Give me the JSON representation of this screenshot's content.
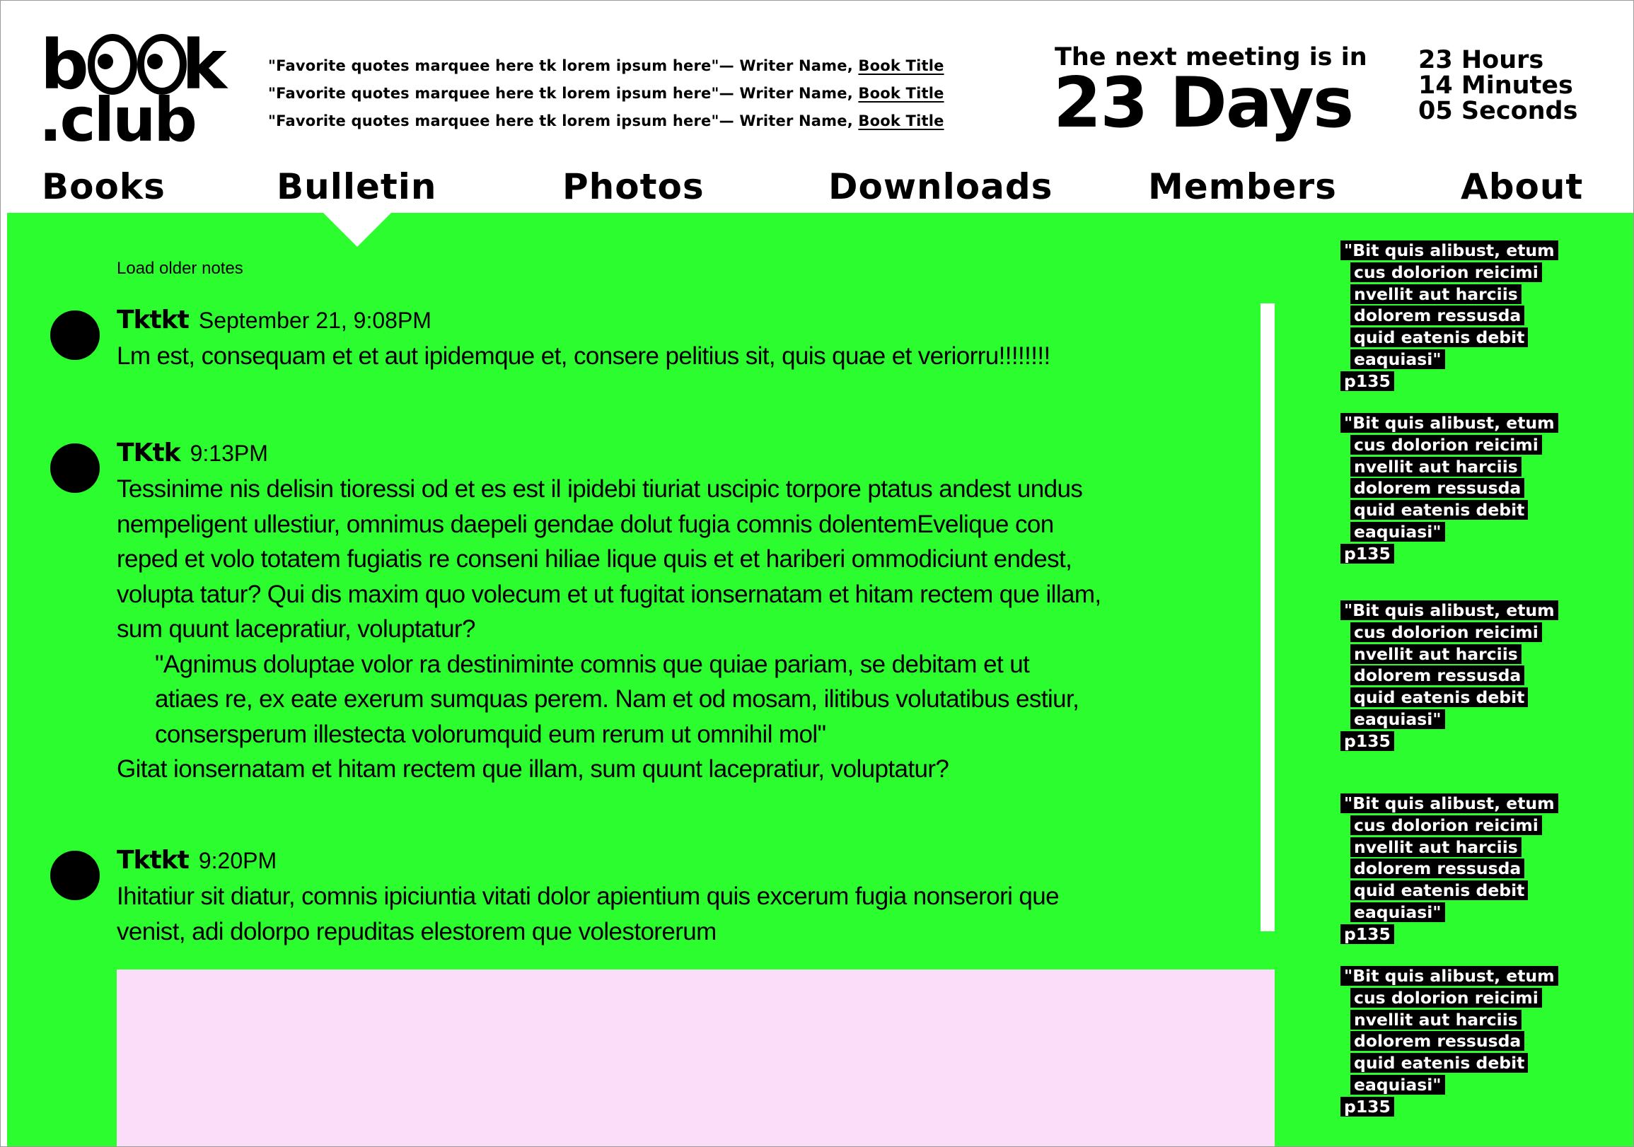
{
  "logo": {
    "top": "b  k",
    "bottom": ".club"
  },
  "header": {
    "quotes": [
      {
        "quote": "\"Favorite quotes marquee here tk lorem ipsum here\"",
        "attribution": "— Writer Name, ",
        "book": "Book Title"
      },
      {
        "quote": "\"Favorite quotes marquee here tk lorem ipsum here\"",
        "attribution": "— Writer Name, ",
        "book": "Book Title"
      },
      {
        "quote": "\"Favorite quotes marquee here tk lorem ipsum here\"",
        "attribution": "— Writer Name, ",
        "book": "Book Title"
      }
    ],
    "countdown": {
      "lead": "The next meeting is in",
      "days": "23 Days",
      "hours": "23 Hours",
      "minutes": "14 Minutes",
      "seconds": "05 Seconds"
    }
  },
  "nav": {
    "items": [
      {
        "label": "Books"
      },
      {
        "label": "Bulletin"
      },
      {
        "label": "Photos"
      },
      {
        "label": "Downloads"
      },
      {
        "label": "Members"
      },
      {
        "label": "About"
      }
    ],
    "active": "Bulletin"
  },
  "feed": {
    "load_older": "Load older notes",
    "posts": [
      {
        "author": "Tktkt",
        "time": "September 21, 9:08PM",
        "body": [
          "Lm est, consequam et et aut ipidemque et, consere pelitius sit, quis quae et veriorru!!!!!!!!"
        ]
      },
      {
        "author": "TKtk",
        "time": "9:13PM",
        "body": [
          "Tessinime nis delisin tioressi od et es est il ipidebi tiuriat uscipic torpore ptatus andest undus",
          "nempeligent ullestiur, omnimus daepeli gendae dolut fugia comnis dolentemEvelique con",
          "reped et volo totatem fugiatis re conseni hiliae lique quis et et hariberi ommodiciunt endest,",
          "volupta tatur? Qui dis maxim quo volecum et ut fugitat ionsernatam et hitam rectem que illam,",
          "sum quunt lacepratiur, voluptatur?"
        ],
        "quote": [
          "\"Agnimus doluptae volor ra destiniminte comnis que quiae pariam, se debitam et ut",
          "atiaes re, ex eate exerum sumquas perem. Nam et od mosam, ilitibus volutatibus estiur,",
          "consersperum illestecta volorumquid eum rerum ut omnihil mol\""
        ],
        "after": [
          "Gitat ionsernatam et hitam rectem que illam, sum quunt lacepratiur, voluptatur?"
        ]
      },
      {
        "author": "Tktkt",
        "time": "9:20PM",
        "body": [
          "Ihitatiur sit diatur, comnis ipiciuntia vitati dolor apientium quis excerum fugia nonserori que",
          "venist, adi dolorpo repuditas elestorem que volestorerum"
        ]
      }
    ]
  },
  "sidebar": {
    "quote_lines": [
      "\"Bit quis alibust, etum",
      "cus dolorion reicimi",
      "nvellit aut harciis",
      "dolorem ressusda",
      "quid eatenis debit",
      "eaquiasi\""
    ],
    "page": "p135",
    "count": 5
  },
  "colors": {
    "background": "#2bfd2f",
    "composer": "#fbdcf9",
    "ink": "#000000",
    "paper": "#ffffff"
  }
}
